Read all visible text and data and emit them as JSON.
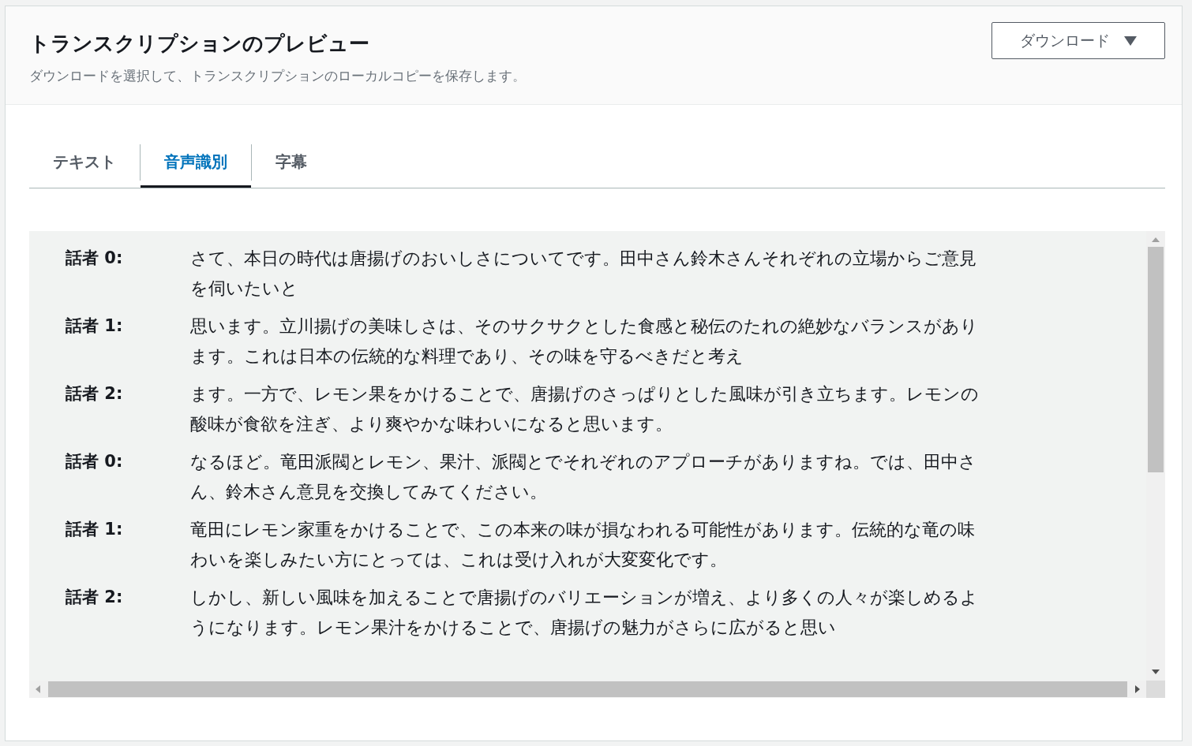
{
  "header": {
    "title": "トランスクリプションのプレビュー",
    "description": "ダウンロードを選択して、トランスクリプションのローカルコピーを保存します。",
    "download_button": "ダウンロード"
  },
  "tabs": [
    {
      "label": "テキスト",
      "selected": false
    },
    {
      "label": "音声識別",
      "selected": true
    },
    {
      "label": "字幕",
      "selected": false
    }
  ],
  "transcript": [
    {
      "speaker": "話者 0:",
      "text": "さて、本日の時代は唐揚げのおいしさについてです。田中さん鈴木さんそれぞれの立場からご意見を伺いたいと"
    },
    {
      "speaker": "話者 1:",
      "text": "思います。立川揚げの美味しさは、そのサクサクとした食感と秘伝のたれの絶妙なバランスがあります。これは日本の伝統的な料理であり、その味を守るべきだと考え"
    },
    {
      "speaker": "話者 2:",
      "text": "ます。一方で、レモン果をかけることで、唐揚げのさっぱりとした風味が引き立ちます。レモンの酸味が食欲を注ぎ、より爽やかな味わいになると思います。"
    },
    {
      "speaker": "話者 0:",
      "text": "なるほど。竜田派閥とレモン、果汁、派閥とでそれぞれのアプローチがありますね。では、田中さん、鈴木さん意見を交換してみてください。"
    },
    {
      "speaker": "話者 1:",
      "text": "竜田にレモン家重をかけることで、この本来の味が損なわれる可能性があります。伝統的な竜の味わいを楽しみたい方にとっては、これは受け入れが大変変化です。"
    },
    {
      "speaker": "話者 2:",
      "text": "しかし、新しい風味を加えることで唐揚げのバリエーションが増え、より多くの人々が楽しめるようになります。レモン果汁をかけることで、唐揚げの魅力がさらに広がると思い"
    }
  ]
}
